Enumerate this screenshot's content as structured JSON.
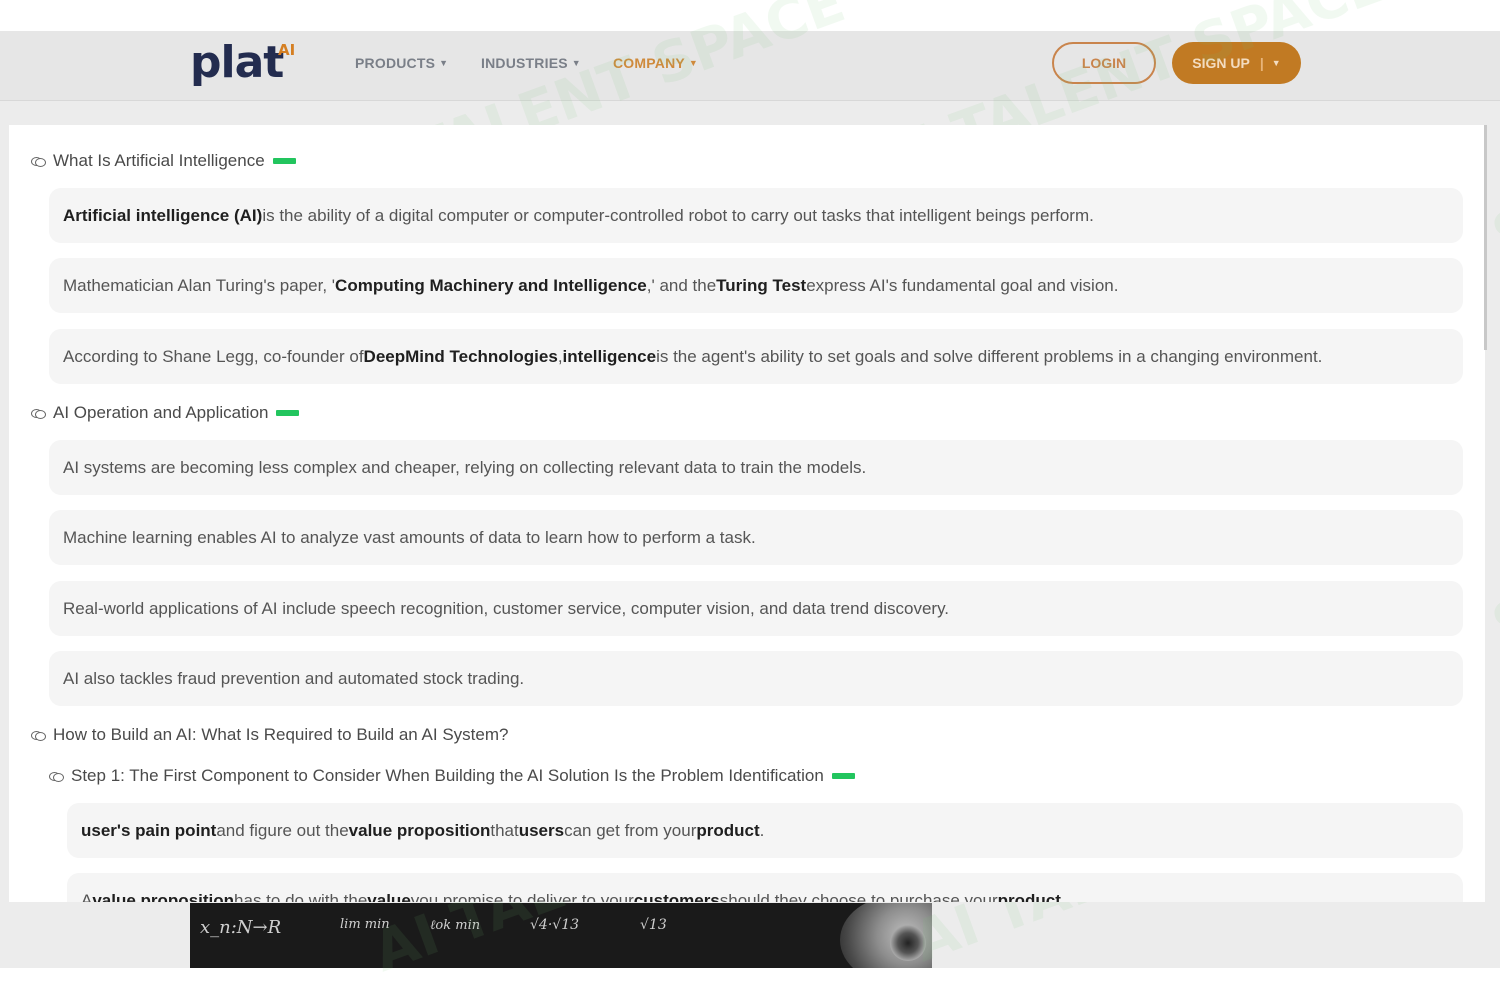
{
  "header": {
    "logo_text": "plat",
    "logo_sup": "AI",
    "nav": [
      {
        "label": "PRODUCTS",
        "active": false
      },
      {
        "label": "INDUSTRIES",
        "active": false
      },
      {
        "label": "COMPANY",
        "active": true
      }
    ],
    "login_label": "LOGIN",
    "signup_label": "SIGN UP"
  },
  "watermark_text": "AI TALENT SPACE",
  "hero_math": [
    "x_n:N→R",
    "lim min",
    "ℓok min",
    "√4·√13",
    "√13"
  ],
  "sections": [
    {
      "title": "What Is Artificial Intelligence",
      "cards": [
        {
          "parts": [
            [
              "b",
              "Artificial intelligence (AI)"
            ],
            [
              "t",
              " is the ability of a digital computer or computer-controlled robot to carry out tasks that intelligent beings perform."
            ]
          ]
        },
        {
          "parts": [
            [
              "t",
              "Mathematician Alan Turing's paper, '"
            ],
            [
              "b",
              "Computing Machinery and Intelligence"
            ],
            [
              "t",
              ",' and the "
            ],
            [
              "b",
              "Turing Test"
            ],
            [
              "t",
              " express AI's fundamental goal and vision."
            ]
          ]
        },
        {
          "parts": [
            [
              "t",
              "According to Shane Legg, co-founder of "
            ],
            [
              "b",
              "DeepMind Technologies"
            ],
            [
              "t",
              ", "
            ],
            [
              "b",
              "intelligence"
            ],
            [
              "t",
              " is the agent's ability to set goals and solve different problems in a changing environment."
            ]
          ]
        }
      ]
    },
    {
      "title": "AI Operation and Application",
      "cards": [
        {
          "parts": [
            [
              "t",
              "AI systems are becoming less complex and cheaper, relying on collecting relevant data to train the models."
            ]
          ]
        },
        {
          "parts": [
            [
              "t",
              "Machine learning enables AI to analyze vast amounts of data to learn how to perform a task."
            ]
          ]
        },
        {
          "parts": [
            [
              "t",
              "Real-world applications of AI include speech recognition, customer service, computer vision, and data trend discovery."
            ]
          ]
        },
        {
          "parts": [
            [
              "t",
              "AI also tackles fraud prevention and automated stock trading."
            ]
          ]
        }
      ]
    },
    {
      "title": "How to Build an AI: What Is Required to Build an AI System?",
      "cards": []
    },
    {
      "title": "Step 1: The First Component to Consider When Building the AI Solution Is the Problem Identification",
      "cards": [
        {
          "parts": [
            [
              "b",
              "user's pain point"
            ],
            [
              "t",
              " and figure out the "
            ],
            [
              "b",
              "value proposition"
            ],
            [
              "t",
              " that "
            ],
            [
              "b",
              "users"
            ],
            [
              "t",
              " can get from your "
            ],
            [
              "b",
              "product"
            ],
            [
              "t",
              "."
            ]
          ]
        },
        {
          "parts": [
            [
              "t",
              "A "
            ],
            [
              "b",
              "value proposition"
            ],
            [
              "t",
              " has to do with the "
            ],
            [
              "b",
              "value"
            ],
            [
              "t",
              " you promise to deliver to your "
            ],
            [
              "b",
              "customers"
            ],
            [
              "t",
              " should they choose to purchase your "
            ],
            [
              "b",
              "product"
            ],
            [
              "t",
              "."
            ]
          ]
        }
      ]
    }
  ],
  "colors": {
    "accent_green": "#22c55e",
    "brand_orange": "#c17a23",
    "logo_navy": "#232c4f"
  }
}
